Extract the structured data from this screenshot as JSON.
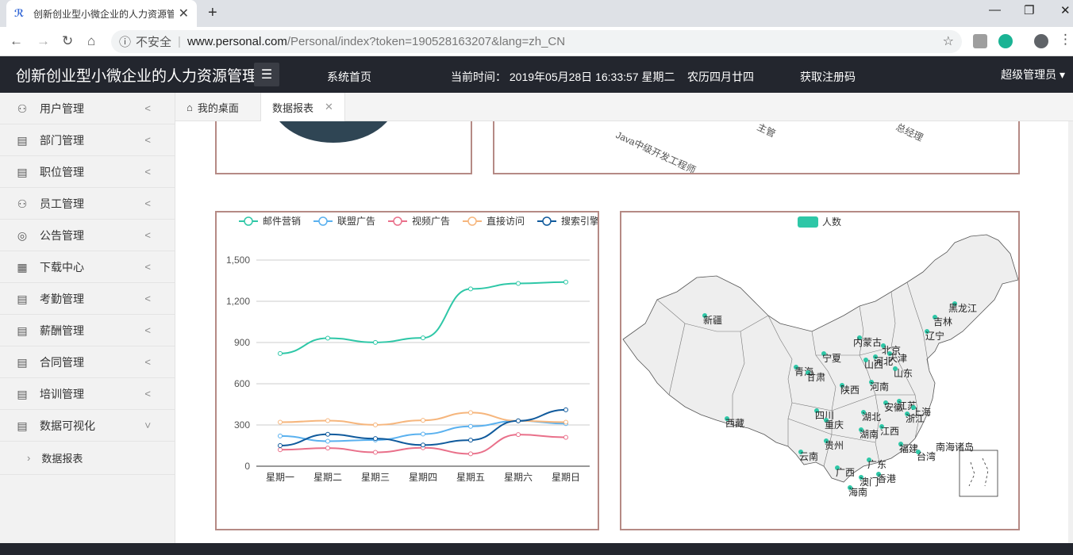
{
  "browser": {
    "tab_title": "创新创业型小微企业的人力资源管",
    "insecure_label": "不安全",
    "url_host": "www.personal.com",
    "url_path": "/Personal/index?token=190528163207&lang=zh_CN"
  },
  "header": {
    "title": "创新创业型小微企业的人力资源管理",
    "home_link": "系统首页",
    "current_time": "当前时间： 2019年05月28日 16:33:57 星期二    农历四月廿四",
    "register_link": "获取注册码",
    "user": "超级管理员"
  },
  "sidebar": {
    "items": [
      {
        "label": "用户管理",
        "icon": "user-icon"
      },
      {
        "label": "部门管理",
        "icon": "document-icon"
      },
      {
        "label": "职位管理",
        "icon": "document-icon"
      },
      {
        "label": "员工管理",
        "icon": "user-icon"
      },
      {
        "label": "公告管理",
        "icon": "globe-icon"
      },
      {
        "label": "下载中心",
        "icon": "grid-icon"
      },
      {
        "label": "考勤管理",
        "icon": "document-icon"
      },
      {
        "label": "薪酬管理",
        "icon": "document-icon"
      },
      {
        "label": "合同管理",
        "icon": "document-icon"
      },
      {
        "label": "培训管理",
        "icon": "document-icon"
      },
      {
        "label": "数据可视化",
        "icon": "document-icon"
      }
    ],
    "sub_item": "数据报表"
  },
  "tabs": {
    "desk": "我的桌面",
    "report": "数据报表"
  },
  "top_chart_labels": [
    "Java中级开发工程师",
    "主管",
    "总经理"
  ],
  "colors": {
    "email": "#2ec7a7",
    "union": "#5ab1ef",
    "video": "#e9708a",
    "direct": "#f6b67d",
    "search": "#105a9c",
    "map_fill": "#eeeeee",
    "map_dot": "#2ec7a7",
    "panel_border": "#b58a85",
    "header_bg": "#23262e"
  },
  "chart_data": [
    {
      "type": "line",
      "categories": [
        "星期一",
        "星期二",
        "星期三",
        "星期四",
        "星期五",
        "星期六",
        "星期日"
      ],
      "ylim": [
        0,
        1500
      ],
      "yticks": [
        "0",
        "300",
        "600",
        "900",
        "1,200",
        "1,500"
      ],
      "legend_position": "top",
      "series": [
        {
          "name": "邮件营销",
          "values": [
            820,
            932,
            901,
            934,
            1290,
            1330,
            1340
          ]
        },
        {
          "name": "联盟广告",
          "values": [
            220,
            182,
            191,
            234,
            290,
            330,
            310
          ]
        },
        {
          "name": "视频广告",
          "values": [
            120,
            132,
            101,
            134,
            90,
            230,
            210
          ]
        },
        {
          "name": "直接访问",
          "values": [
            320,
            332,
            301,
            334,
            390,
            330,
            320
          ]
        },
        {
          "name": "搜索引擎",
          "values": [
            150,
            232,
            201,
            154,
            190,
            330,
            410
          ]
        }
      ]
    },
    {
      "type": "map",
      "legend": "人数",
      "legend_position": "top",
      "regions": [
        "新疆",
        "西藏",
        "青海",
        "甘肃",
        "宁夏",
        "内蒙古",
        "黑龙江",
        "吉林",
        "辽宁",
        "北京",
        "天津",
        "河北",
        "山西",
        "山东",
        "陕西",
        "河南",
        "四川",
        "重庆",
        "湖北",
        "安徽",
        "江苏",
        "上海",
        "浙江",
        "湖南",
        "江西",
        "贵州",
        "云南",
        "广西",
        "广东",
        "福建",
        "台湾",
        "海南",
        "香港",
        "澳门",
        "南海诸岛"
      ]
    }
  ]
}
